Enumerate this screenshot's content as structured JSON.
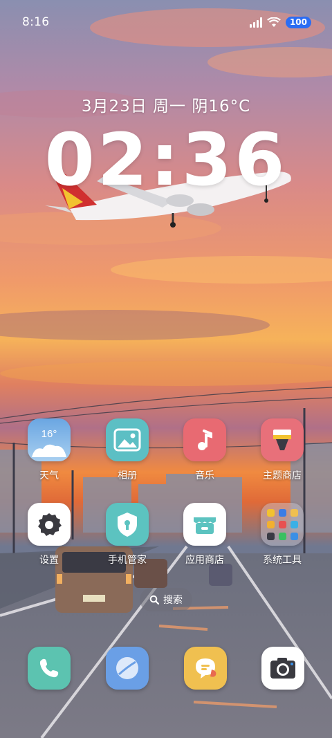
{
  "status_bar": {
    "time": "8:16",
    "battery": "100",
    "icons": [
      "signal-icon",
      "wifi-icon",
      "battery-icon"
    ]
  },
  "lockscreen": {
    "date_weather": "3月23日 周一 阴16°C",
    "clock": "02:36"
  },
  "apps": [
    {
      "label": "天气",
      "icon": "weather-icon",
      "temp": "16°"
    },
    {
      "label": "相册",
      "icon": "gallery-icon"
    },
    {
      "label": "音乐",
      "icon": "music-icon"
    },
    {
      "label": "主题商店",
      "icon": "theme-brush-icon"
    },
    {
      "label": "设置",
      "icon": "settings-gear-icon"
    },
    {
      "label": "手机管家",
      "icon": "security-shield-icon"
    },
    {
      "label": "应用商店",
      "icon": "app-store-icon"
    },
    {
      "label": "系统工具",
      "icon": "system-tools-folder-icon"
    }
  ],
  "search": {
    "label": "搜索",
    "icon": "search-icon"
  },
  "dock": [
    {
      "icon": "phone-icon"
    },
    {
      "icon": "browser-icon"
    },
    {
      "icon": "messages-icon"
    },
    {
      "icon": "camera-icon"
    }
  ],
  "colors": {
    "weather": "#7fb4e6",
    "gallery": "#5cbfc4",
    "music": "#e86a72",
    "theme": "#e8707a",
    "settings": "#ffffff",
    "security": "#5cc3c0",
    "store": "#ffffff",
    "phone": "#5cc3b0",
    "browser": "#6a9fe6",
    "messages": "#f0c050",
    "camera": "#ffffff",
    "battery_badge": "#2b6df3"
  }
}
